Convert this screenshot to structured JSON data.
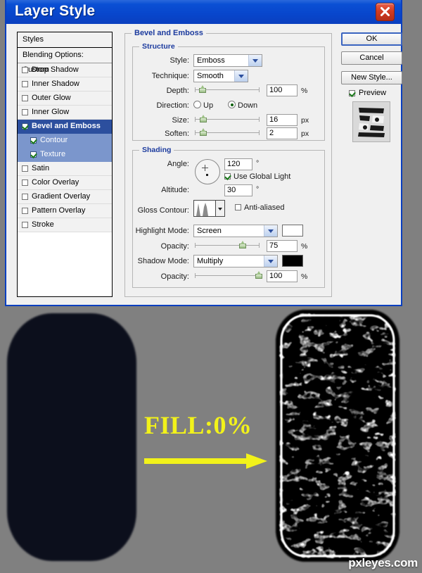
{
  "window": {
    "title": "Layer Style",
    "close_icon": "close-icon"
  },
  "styles_panel": {
    "header": "Styles",
    "blending_options": "Blending Options: Custom",
    "items": [
      {
        "label": "Drop Shadow",
        "checked": false,
        "selected": false,
        "sub": false
      },
      {
        "label": "Inner Shadow",
        "checked": false,
        "selected": false,
        "sub": false
      },
      {
        "label": "Outer Glow",
        "checked": false,
        "selected": false,
        "sub": false
      },
      {
        "label": "Inner Glow",
        "checked": false,
        "selected": false,
        "sub": false
      },
      {
        "label": "Bevel and Emboss",
        "checked": true,
        "selected": true,
        "sub": false
      },
      {
        "label": "Contour",
        "checked": true,
        "selected": false,
        "sub": true
      },
      {
        "label": "Texture",
        "checked": true,
        "selected": false,
        "sub": true
      },
      {
        "label": "Satin",
        "checked": false,
        "selected": false,
        "sub": false
      },
      {
        "label": "Color Overlay",
        "checked": false,
        "selected": false,
        "sub": false
      },
      {
        "label": "Gradient Overlay",
        "checked": false,
        "selected": false,
        "sub": false
      },
      {
        "label": "Pattern Overlay",
        "checked": false,
        "selected": false,
        "sub": false
      },
      {
        "label": "Stroke",
        "checked": false,
        "selected": false,
        "sub": false
      }
    ]
  },
  "panel": {
    "title": "Bevel and Emboss",
    "structure": {
      "title": "Structure",
      "style_label": "Style:",
      "style_value": "Emboss",
      "technique_label": "Technique:",
      "technique_value": "Smooth",
      "depth_label": "Depth:",
      "depth_value": "100",
      "depth_unit": "%",
      "direction_label": "Direction:",
      "direction_up": "Up",
      "direction_down": "Down",
      "direction_selected": "Down",
      "size_label": "Size:",
      "size_value": "16",
      "size_unit": "px",
      "soften_label": "Soften:",
      "soften_value": "2",
      "soften_unit": "px"
    },
    "shading": {
      "title": "Shading",
      "angle_label": "Angle:",
      "angle_value": "120",
      "angle_unit": "°",
      "global_light_label": "Use Global Light",
      "global_light_checked": true,
      "altitude_label": "Altitude:",
      "altitude_value": "30",
      "altitude_unit": "°",
      "gloss_contour_label": "Gloss Contour:",
      "anti_aliased_label": "Anti-aliased",
      "anti_aliased_checked": false,
      "highlight_mode_label": "Highlight Mode:",
      "highlight_mode_value": "Screen",
      "highlight_color": "#ffffff",
      "highlight_opacity_label": "Opacity:",
      "highlight_opacity_value": "75",
      "highlight_opacity_unit": "%",
      "shadow_mode_label": "Shadow Mode:",
      "shadow_mode_value": "Multiply",
      "shadow_color": "#000000",
      "shadow_opacity_label": "Opacity:",
      "shadow_opacity_value": "100",
      "shadow_opacity_unit": "%"
    }
  },
  "buttons": {
    "ok": "OK",
    "cancel": "Cancel",
    "new_style": "New Style...",
    "preview_label": "Preview",
    "preview_checked": true
  },
  "photo": {
    "fill_text": "FILL:0%",
    "watermark": "pxleyes.com",
    "arrow_color": "#f2f21a",
    "background_color": "#808080",
    "left_shape_color": "#0c0f1c"
  }
}
